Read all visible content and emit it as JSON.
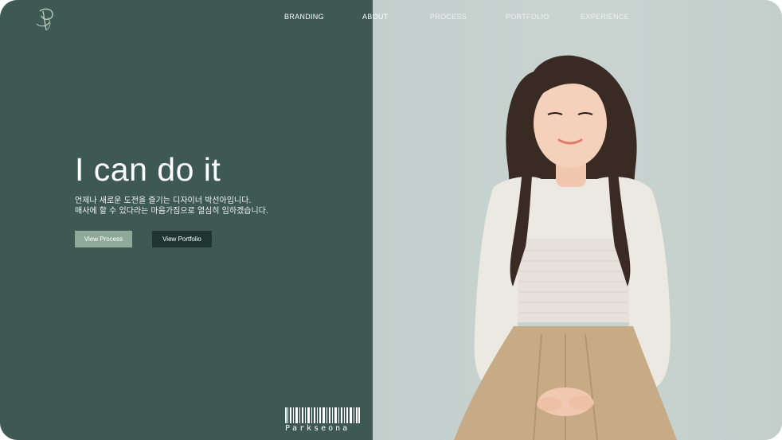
{
  "nav": {
    "items": [
      "BRANDING",
      "ABOUT",
      "PROCESS",
      "PORTFOLIO",
      "EXPERIENCE"
    ]
  },
  "hero": {
    "headline": "I can do it",
    "subline_1": "언제나 새로운 도전을 즐기는 디자이너 박선아입니다.",
    "subline_2": "매사에 할 수 있다라는 마음가짐으로 열심히 임하겠습니다."
  },
  "buttons": {
    "process_label": "View Process",
    "portfolio_label": "View Portfolio"
  },
  "footer": {
    "barcode_name": "Parkseona"
  },
  "icons": {
    "logo": "monogram-logo-icon",
    "barcode": "barcode-icon"
  },
  "colors": {
    "left_panel": "#3e5953",
    "right_panel": "#c7d2cf",
    "button_process": "#8faa98",
    "button_portfolio": "#1f3630"
  }
}
